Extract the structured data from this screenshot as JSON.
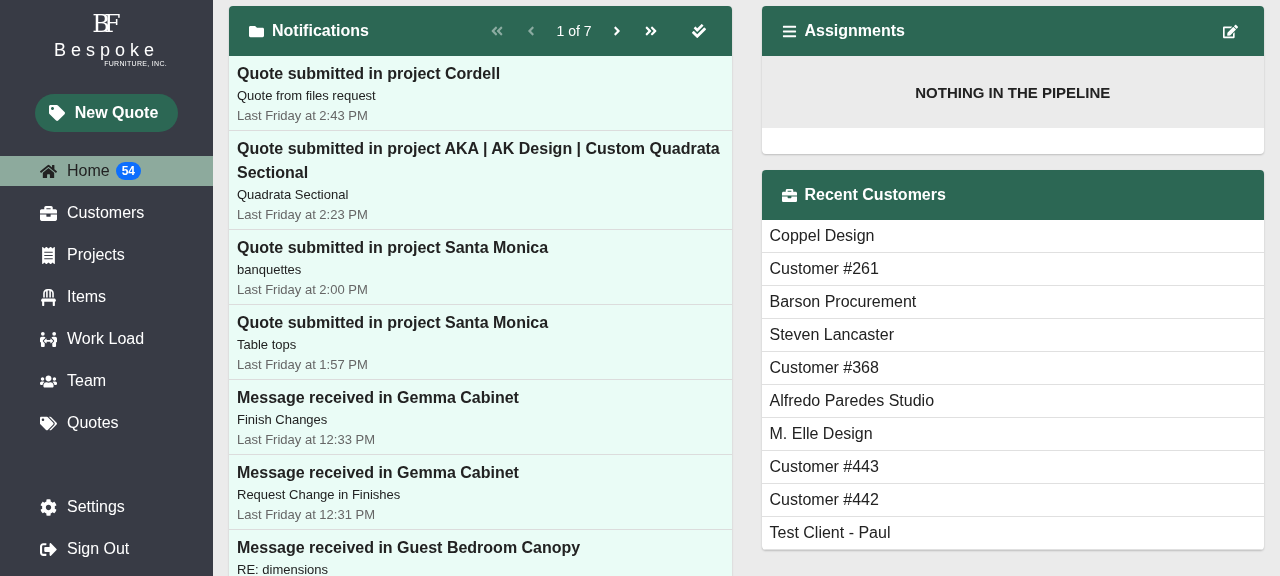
{
  "sidebar": {
    "logo": {
      "monogram": "BF",
      "name": "Bespoke",
      "tagline": "FURNITURE, INC."
    },
    "new_quote_button": "New Quote",
    "items": [
      {
        "label": "Home",
        "badge": "54",
        "selected": true
      },
      {
        "label": "Customers",
        "selected": false
      },
      {
        "label": "Projects",
        "selected": false
      },
      {
        "label": "Items",
        "selected": false
      },
      {
        "label": "Work Load",
        "selected": false
      },
      {
        "label": "Team",
        "selected": false
      },
      {
        "label": "Quotes",
        "selected": false
      }
    ],
    "bottom_items": [
      {
        "label": "Settings",
        "selected": false
      },
      {
        "label": "Sign Out",
        "selected": false
      }
    ]
  },
  "notifications": {
    "title": "Notifications",
    "pager": {
      "text": "1 of 7",
      "first_disabled": true,
      "prev_disabled": true,
      "next_disabled": false,
      "last_disabled": false
    },
    "items": [
      {
        "title": "Quote submitted in project Cordell",
        "subtitle": "Quote from files request",
        "time": "Last Friday at 2:43 PM"
      },
      {
        "title": "Quote submitted in project AKA | AK Design | Custom Quadrata Sectional",
        "subtitle": "Quadrata Sectional",
        "time": "Last Friday at 2:23 PM"
      },
      {
        "title": "Quote submitted in project Santa Monica",
        "subtitle": "banquettes",
        "time": "Last Friday at 2:00 PM"
      },
      {
        "title": "Quote submitted in project Santa Monica",
        "subtitle": "Table tops",
        "time": "Last Friday at 1:57 PM"
      },
      {
        "title": "Message received in Gemma Cabinet",
        "subtitle": "Finish Changes",
        "time": "Last Friday at 12:33 PM"
      },
      {
        "title": "Message received in Gemma Cabinet",
        "subtitle": "Request Change in Finishes",
        "time": "Last Friday at 12:31 PM"
      },
      {
        "title": "Message received in Guest Bedroom Canopy",
        "subtitle": "RE: dimensions"
      }
    ]
  },
  "assignments": {
    "title": "Assignments",
    "empty_text": "NOTHING IN THE PIPELINE"
  },
  "recent_customers": {
    "title": "Recent Customers",
    "items": [
      "Coppel Design",
      "Customer #261",
      "Barson Procurement",
      "Steven Lancaster",
      "Customer #368",
      "Alfredo Paredes Studio",
      "M. Elle Design",
      "Customer #443",
      "Customer #442",
      "Test Client - Paul"
    ]
  }
}
